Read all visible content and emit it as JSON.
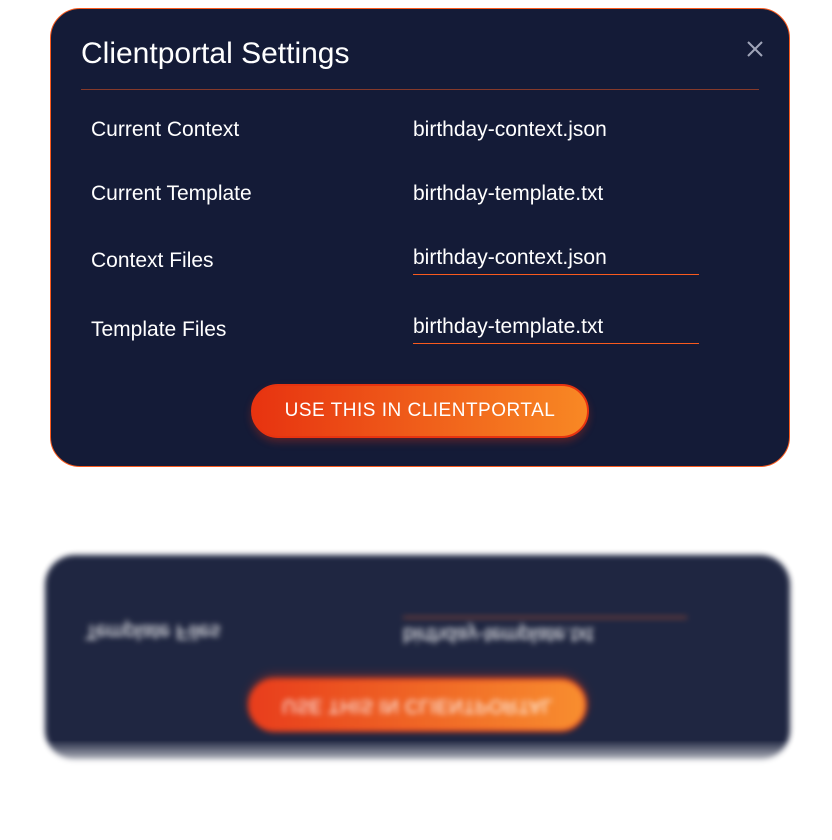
{
  "modal": {
    "title": "Clientportal Settings",
    "rows": {
      "current_context": {
        "label": "Current Context",
        "value": "birthday-context.json"
      },
      "current_template": {
        "label": "Current Template",
        "value": "birthday-template.txt"
      },
      "context_files": {
        "label": "Context Files",
        "selected": "birthday-context.json"
      },
      "template_files": {
        "label": "Template Files",
        "selected": "birthday-template.txt"
      }
    },
    "action_button": "USE THIS IN CLIENTPORTAL"
  }
}
